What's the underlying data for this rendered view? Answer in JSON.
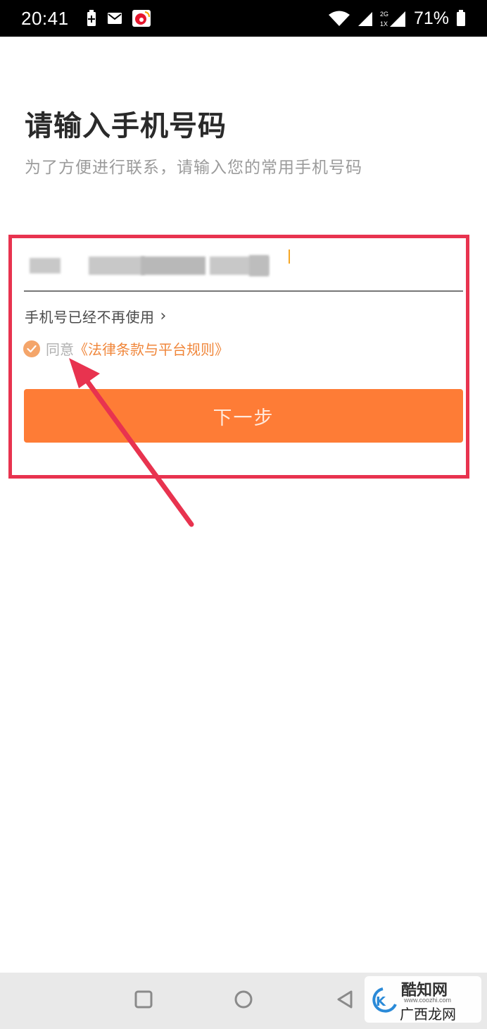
{
  "status_bar": {
    "time": "20:41",
    "battery_percent": "71%",
    "signal_label_top": "2G",
    "signal_label_bottom": "1X",
    "icons": [
      "battery-saver-icon",
      "mail-icon",
      "sina-icon",
      "wifi-icon",
      "signal-icon",
      "battery-icon"
    ]
  },
  "page": {
    "title": "请输入手机号码",
    "subtitle": "为了方便进行联系，请输入您的常用手机号码"
  },
  "phone_input": {
    "value": ""
  },
  "links": {
    "number_not_used": "手机号已经不再使用",
    "chevron": "›"
  },
  "agreement": {
    "checked": true,
    "prefix": "同意",
    "link": "《法律条款与平台规则》"
  },
  "next_button": {
    "label": "下一步"
  },
  "colors": {
    "accent_orange": "#fe7c36",
    "link_orange": "#f0863a",
    "highlight_red": "#e8334f",
    "arrow_red": "#e8334f"
  },
  "watermark": {
    "main": "酷知网",
    "url": "www.coozhi.com",
    "sub": "广西龙网"
  }
}
